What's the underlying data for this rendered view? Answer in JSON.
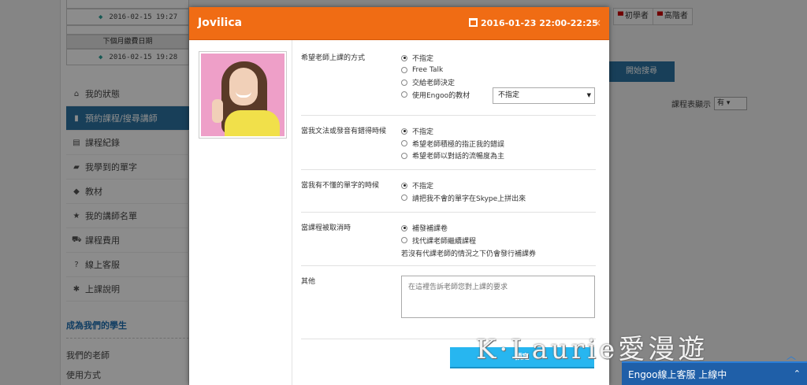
{
  "background": {
    "schedule": {
      "dates": [
        "2016-02-15 19:27",
        "2016-02-15 19:28"
      ],
      "next_month_header": "下個月繳費日期"
    },
    "menu": [
      {
        "icon": "home-icon",
        "glyph": "⌂",
        "label": "我的狀態"
      },
      {
        "icon": "book-icon",
        "glyph": "▮",
        "label": "預約課程/搜尋講師",
        "active": true
      },
      {
        "icon": "list-icon",
        "glyph": "▤",
        "label": "課程紀錄"
      },
      {
        "icon": "folder-icon",
        "glyph": "▰",
        "label": "我學到的單字"
      },
      {
        "icon": "tags-icon",
        "glyph": "◆",
        "label": "教材"
      },
      {
        "icon": "star-icon",
        "glyph": "★",
        "label": "我的講師名單"
      },
      {
        "icon": "cart-icon",
        "glyph": "⛟",
        "label": "課程費用"
      },
      {
        "icon": "help-icon",
        "glyph": "?",
        "label": "線上客服"
      },
      {
        "icon": "gear-icon",
        "glyph": "✱",
        "label": "上課說明"
      }
    ],
    "become_student": "成為我們的學生",
    "our_teachers": "我們的老師",
    "usage": "使用方式",
    "level_buttons": [
      "初學者",
      "高階者"
    ],
    "search_button": "開始搜尋",
    "show_schedule_label": "課程表顯示",
    "show_schedule_value": "有",
    "watermark": "K·Laurie愛漫遊",
    "chat_bar": "Engoo線上客服 上線中",
    "colors": {
      "accent": "#f06c14",
      "primary": "#2d74a3",
      "book": "#27b6f0"
    }
  },
  "modal": {
    "teacher_name": "Jovilica",
    "datetime": "2016-01-23 22:00-22:25",
    "close": "×",
    "sections": [
      {
        "label": "希望老師上課的方式",
        "options": [
          {
            "text": "不指定",
            "selected": true
          },
          {
            "text": "Free Talk",
            "selected": false
          },
          {
            "text": "交給老師決定",
            "selected": false
          },
          {
            "text": "使用Engoo的教材",
            "selected": false
          }
        ],
        "material_select": "不指定"
      },
      {
        "label": "當我文法或發音有錯得時候",
        "options": [
          {
            "text": "不指定",
            "selected": true
          },
          {
            "text": "希望老師積極的指正我的錯誤",
            "selected": false
          },
          {
            "text": "希望老師以對話的流暢度為主",
            "selected": false
          }
        ]
      },
      {
        "label": "當我有不懂的單字的時候",
        "options": [
          {
            "text": "不指定",
            "selected": true
          },
          {
            "text": "請把我不會的單字在Skype上拼出來",
            "selected": false
          }
        ]
      },
      {
        "label": "當課程被取消時",
        "options": [
          {
            "text": "補發補課卷",
            "selected": true
          },
          {
            "text": "找代課老師繼續課程",
            "selected": false
          }
        ],
        "note": "若沒有代課老師的情況之下仍會發行補課券"
      }
    ],
    "other_label": "其他",
    "other_placeholder": "在這裡告訴老師您對上課的要求",
    "book_button": "預定"
  }
}
